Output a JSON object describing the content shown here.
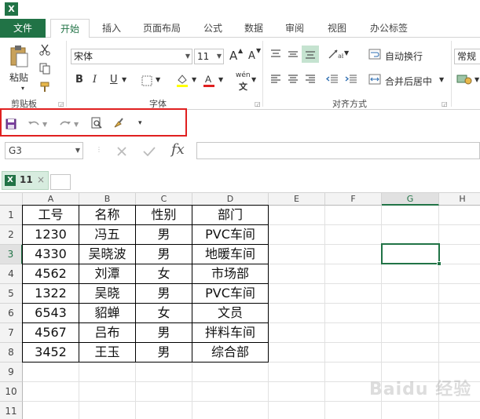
{
  "app": {
    "logo_letter": "X"
  },
  "ribbon_tabs": [
    {
      "id": "file",
      "label": "文件"
    },
    {
      "id": "home",
      "label": "开始"
    },
    {
      "id": "insert",
      "label": "插入"
    },
    {
      "id": "layout",
      "label": "页面布局"
    },
    {
      "id": "formulas",
      "label": "公式"
    },
    {
      "id": "data",
      "label": "数据"
    },
    {
      "id": "review",
      "label": "审阅"
    },
    {
      "id": "view",
      "label": "视图"
    },
    {
      "id": "office_tab",
      "label": "办公标签"
    }
  ],
  "clipboard": {
    "paste_label": "粘贴",
    "group_label": "剪贴板"
  },
  "font": {
    "name": "宋体",
    "size": "11",
    "group_label": "字体",
    "bold": "B",
    "italic": "I",
    "underline": "U",
    "grow": "A",
    "shrink": "A",
    "pinyin": "wén"
  },
  "alignment": {
    "wrap_label": "自动换行",
    "merge_label": "合并后居中",
    "group_label": "对齐方式"
  },
  "number": {
    "format": "常规"
  },
  "formula_bar": {
    "name_box": "G3",
    "fx": "fx",
    "value": ""
  },
  "workbook_tab": {
    "label": "11",
    "close": "×"
  },
  "columns": [
    "A",
    "B",
    "C",
    "D",
    "E",
    "F",
    "G",
    "H"
  ],
  "rows": [
    "1",
    "2",
    "3",
    "4",
    "5",
    "6",
    "7",
    "8",
    "9",
    "10",
    "11"
  ],
  "table": {
    "headers": [
      "工号",
      "名称",
      "性别",
      "部门"
    ],
    "rows": [
      [
        "1230",
        "冯五",
        "男",
        "PVC车间"
      ],
      [
        "4330",
        "吴晓波",
        "男",
        "地暖车间"
      ],
      [
        "4562",
        "刘潭",
        "女",
        "市场部"
      ],
      [
        "1322",
        "吴晓",
        "男",
        "PVC车间"
      ],
      [
        "6543",
        "貂蝉",
        "女",
        "文员"
      ],
      [
        "4567",
        "吕布",
        "男",
        "拌料车间"
      ],
      [
        "3452",
        "王玉",
        "男",
        "综合部"
      ]
    ]
  },
  "selected_cell": "G3",
  "watermark": "Baidu 经验",
  "colors": {
    "excel_green": "#217346",
    "highlight_red": "#e02020"
  }
}
